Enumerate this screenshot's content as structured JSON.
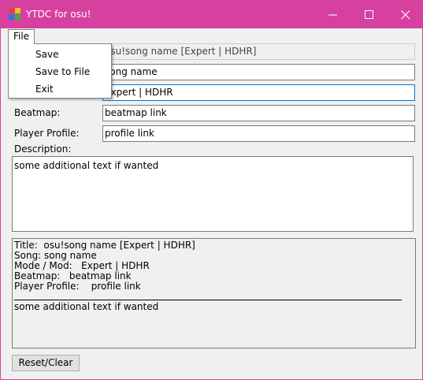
{
  "window": {
    "title": "YTDC for osu!",
    "accent_color": "#d6409f",
    "icons": {
      "app": "app-icon",
      "minimize": "minimize-icon",
      "maximize": "maximize-icon",
      "close": "close-icon"
    }
  },
  "menu": {
    "file_label": "File",
    "items": [
      "Save",
      "Save to File",
      "Exit"
    ]
  },
  "form": {
    "title_value": "osu!song name [Expert | HDHR]",
    "song_value": "song name",
    "mode_value": "Expert | HDHR",
    "beatmap_label": "Beatmap:",
    "beatmap_value": "beatmap link",
    "profile_label": "Player Profile:",
    "profile_value": "profile link",
    "description_label": "Description:",
    "description_value": "some additional text if wanted"
  },
  "preview": {
    "lines": [
      "Title:  osu!song name [Expert | HDHR]",
      "Song: song name",
      "Mode / Mod:   Expert | HDHR",
      "Beatmap:   beatmap link",
      "Player Profile:    profile link"
    ],
    "extra": "some additional text if wanted"
  },
  "buttons": {
    "reset_label": "Reset/Clear"
  }
}
